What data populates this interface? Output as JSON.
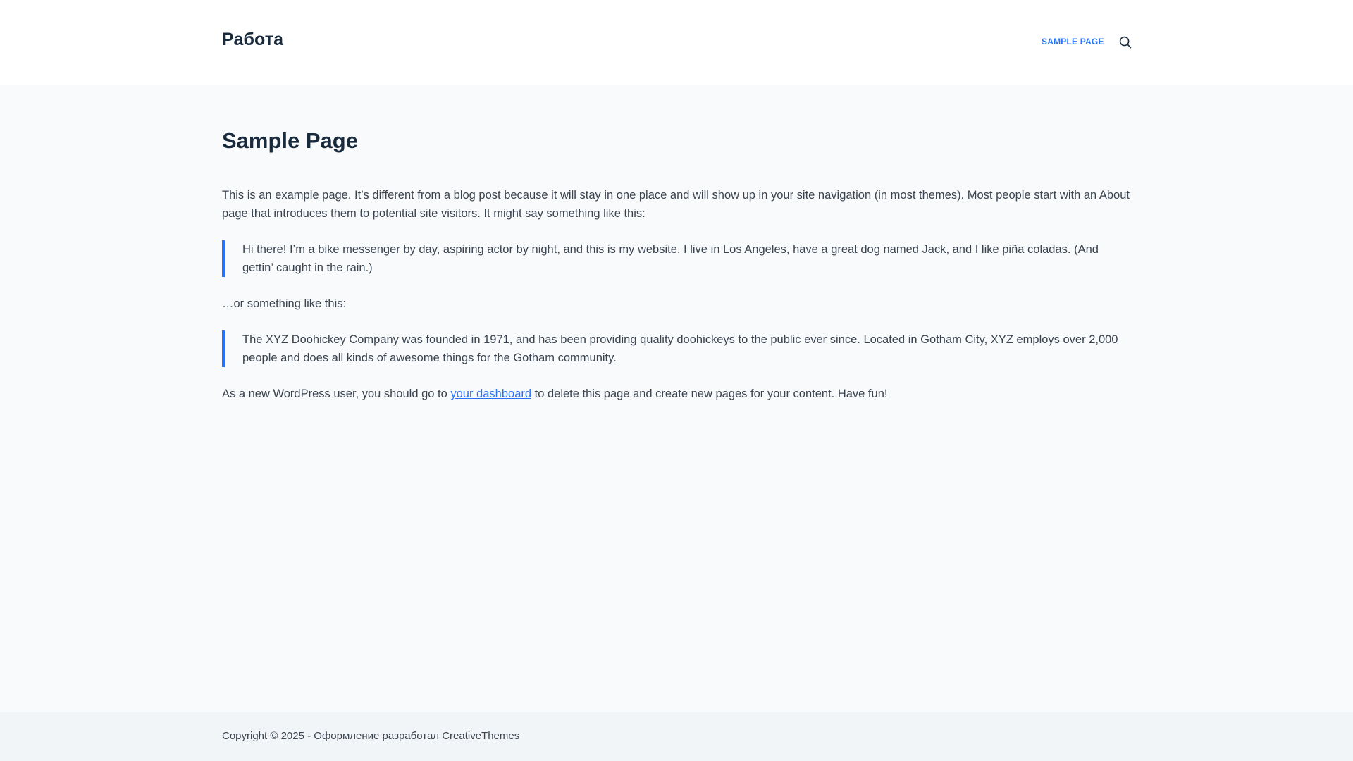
{
  "header": {
    "site_title": "Работа",
    "nav": {
      "sample_page": "SAMPLE PAGE"
    }
  },
  "page": {
    "title": "Sample Page",
    "intro": "This is an example page. It’s different from a blog post because it will stay in one place and will show up in your site navigation (in most themes). Most people start with an About page that introduces them to potential site visitors. It might say something like this:",
    "quote1": "Hi there! I’m a bike messenger by day, aspiring actor by night, and this is my website. I live in Los Angeles, have a great dog named Jack, and I like piña coladas. (And gettin’ caught in the rain.)",
    "or_text": "…or something like this:",
    "quote2": "The XYZ Doohickey Company was founded in 1971, and has been providing quality doohickeys to the public ever since. Located in Gotham City, XYZ employs over 2,000 people and does all kinds of awesome things for the Gotham community.",
    "closing_before": "As a new WordPress user, you should go to ",
    "closing_link": "your dashboard",
    "closing_after": " to delete this page and create new pages for your content. Have fun!"
  },
  "footer": {
    "copyright": "Copyright © 2025 - Оформление разработал CreativeThemes"
  },
  "colors": {
    "accent": "#2872fa",
    "heading": "#192a3d",
    "text": "#3a4350",
    "page_bg": "#f9fafb",
    "header_bg": "#ffffff",
    "footer_bg": "#f2f5f7"
  },
  "icons": {
    "search": "search-icon"
  }
}
